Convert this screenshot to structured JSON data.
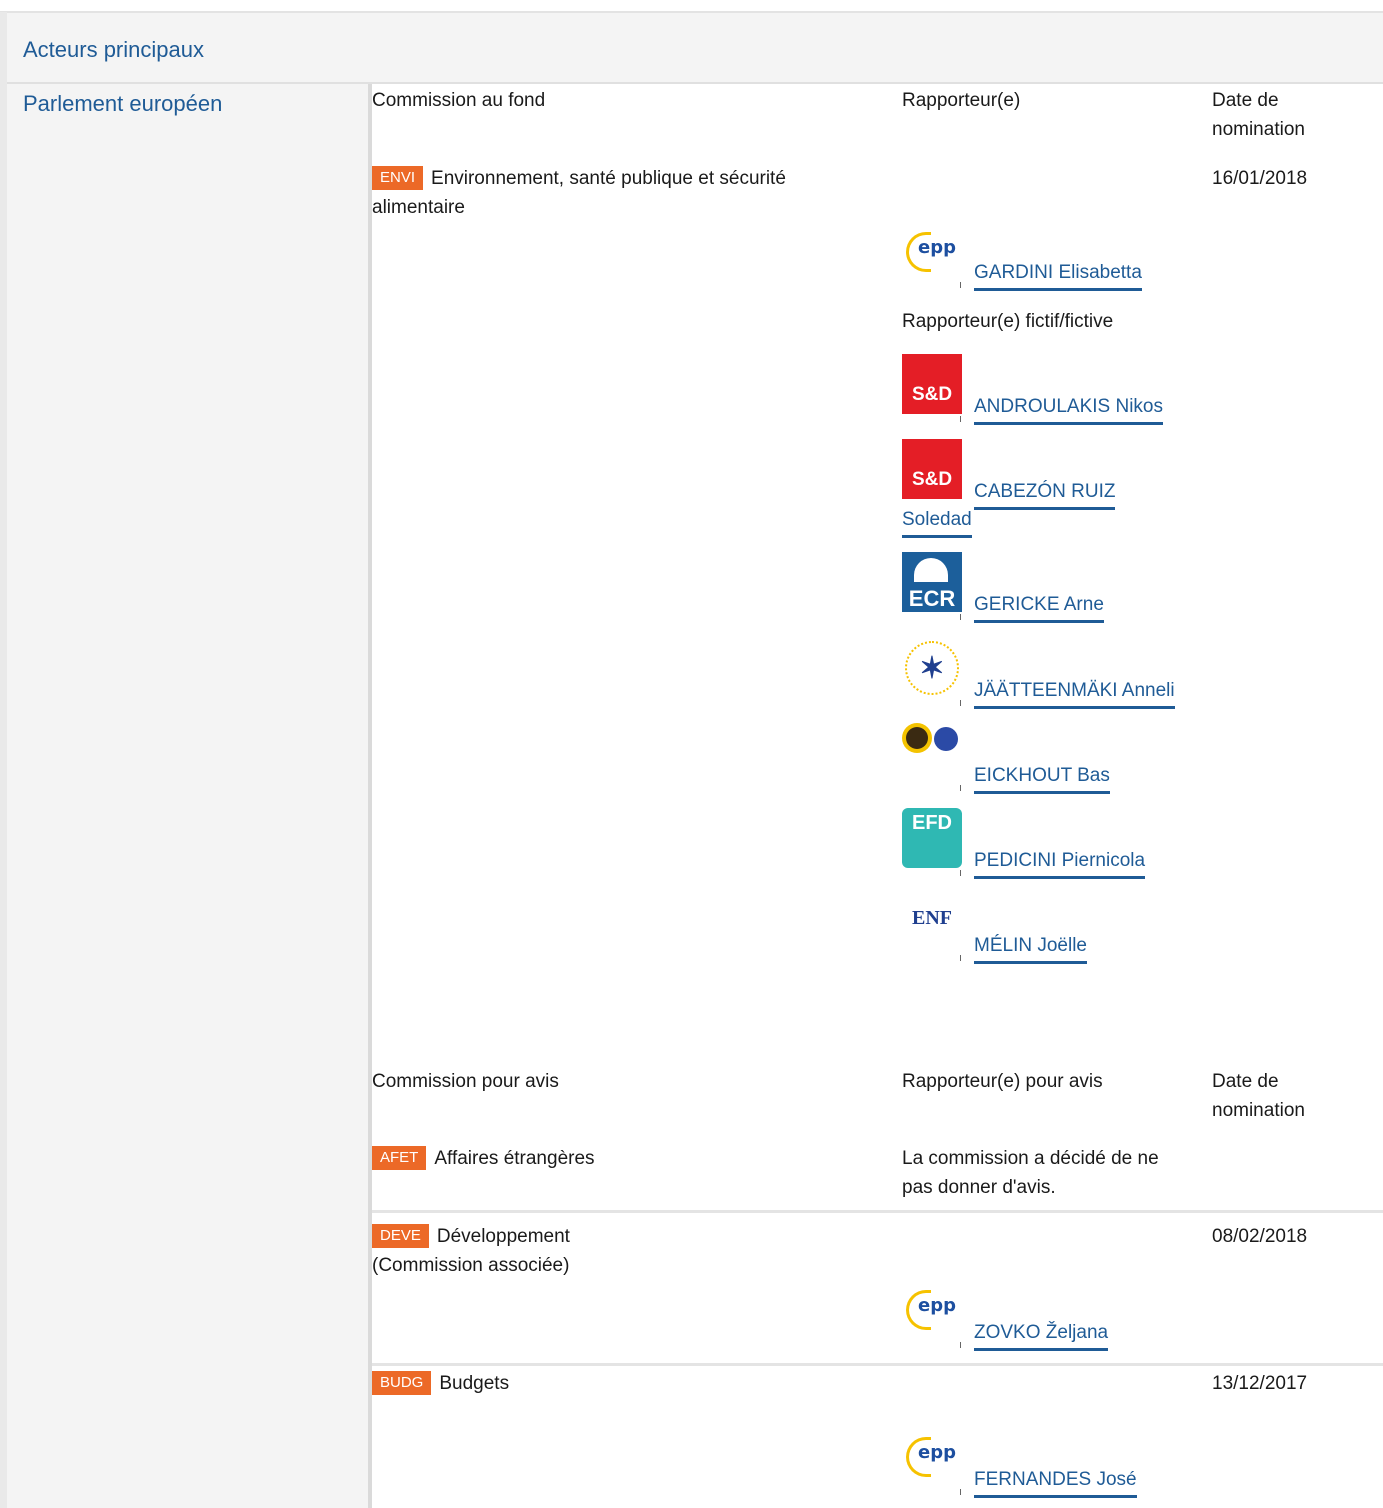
{
  "header": {
    "title": "Acteurs principaux"
  },
  "sidebar": {
    "institution": "Parlement européen"
  },
  "lead": {
    "col_committee": "Commission au fond",
    "col_rapporteur": "Rapporteur(e)",
    "col_date_line1": "Date de",
    "col_date_line2": "nomination",
    "committee": {
      "code": "ENVI",
      "name_line1": "Environnement, santé publique et sécurité",
      "name_line2": "alimentaire",
      "date": "16/01/2018"
    },
    "rapporteur": {
      "group_icon": "epp-logo-icon",
      "name": "GARDINI Elisabetta"
    },
    "shadow_label": "Rapporteur(e) fictif/fictive",
    "shadows": [
      {
        "group_icon": "sd-logo-icon",
        "group_text": "S&D",
        "name": "ANDROULAKIS Nikos"
      },
      {
        "group_icon": "sd-logo-icon",
        "group_text": "S&D",
        "name_line1": "CABEZÓN RUIZ",
        "name_line2": "Soledad"
      },
      {
        "group_icon": "ecr-logo-icon",
        "group_text": "ECR",
        "name": "GERICKE Arne"
      },
      {
        "group_icon": "alde-logo-icon",
        "name": "JÄÄTTEENMÄKI Anneli"
      },
      {
        "group_icon": "greens-efa-logo-icon",
        "name": "EICKHOUT Bas"
      },
      {
        "group_icon": "efdd-logo-icon",
        "group_text": "EFD",
        "name": "PEDICINI Piernicola"
      },
      {
        "group_icon": "enf-logo-icon",
        "group_text": "ENF",
        "name": "MÉLIN Joëlle"
      }
    ]
  },
  "opinion": {
    "col_committee": "Commission pour avis",
    "col_rapporteur": "Rapporteur(e) pour avis",
    "col_date_line1": "Date de",
    "col_date_line2": "nomination",
    "committees": [
      {
        "code": "AFET",
        "name": "Affaires étrangères",
        "note_line1": "La commission a décidé de ne",
        "note_line2": "pas donner d'avis."
      },
      {
        "code": "DEVE",
        "name": "Développement",
        "sub": "(Commission associée)",
        "date": "08/02/2018",
        "rapporteur": {
          "group_icon": "epp-logo-icon",
          "name": "ZOVKO Željana"
        }
      },
      {
        "code": "BUDG",
        "name": "Budgets",
        "date": "13/12/2017",
        "rapporteur": {
          "group_icon": "epp-logo-icon",
          "name": "FERNANDES José"
        }
      }
    ]
  },
  "colors": {
    "accent_badge": "#ec6927",
    "link": "#1f5b96",
    "panel_bg": "#f4f4f4"
  }
}
